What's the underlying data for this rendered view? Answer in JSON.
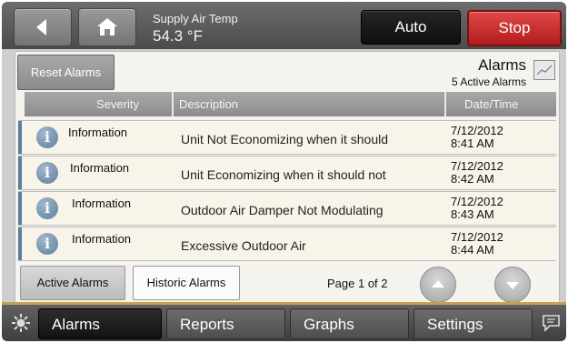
{
  "header": {
    "sensor_label": "Supply Air Temp",
    "sensor_value": "54.3 °F",
    "auto_label": "Auto",
    "stop_label": "Stop"
  },
  "panel": {
    "reset_label": "Reset Alarms",
    "title": "Alarms",
    "active_count": "5 Active Alarms"
  },
  "table": {
    "columns": [
      "Severity",
      "Description",
      "Date/Time"
    ],
    "rows": [
      {
        "severity": "Information",
        "description": "Unit Not Economizing when it should",
        "date": "7/12/2012",
        "time": "8:41 AM"
      },
      {
        "severity": "Information",
        "description": "Unit Economizing when it should not",
        "date": "7/12/2012",
        "time": "8:42 AM"
      },
      {
        "severity": "Information",
        "description": "Outdoor Air Damper Not Modulating",
        "date": "7/12/2012",
        "time": "8:43 AM"
      },
      {
        "severity": "Information",
        "description": "Excessive Outdoor Air",
        "date": "7/12/2012",
        "time": "8:44 AM"
      }
    ]
  },
  "footer": {
    "active_tab": "Active Alarms",
    "historic_tab": "Historic Alarms",
    "page_indicator": "Page 1 of 2"
  },
  "nav": {
    "alarms": "Alarms",
    "reports": "Reports",
    "graphs": "Graphs",
    "settings": "Settings"
  },
  "icons": {
    "back": "back-arrow-icon",
    "home": "home-icon",
    "trend": "trend-chart-icon",
    "info": "info-icon",
    "page_up": "chevron-up-icon",
    "page_down": "chevron-down-icon",
    "status": "sun-gear-icon",
    "messages": "chat-icon"
  },
  "colors": {
    "stop": "#c62828",
    "info": "#5e7f9c",
    "accent_line": "#c4a24a"
  }
}
